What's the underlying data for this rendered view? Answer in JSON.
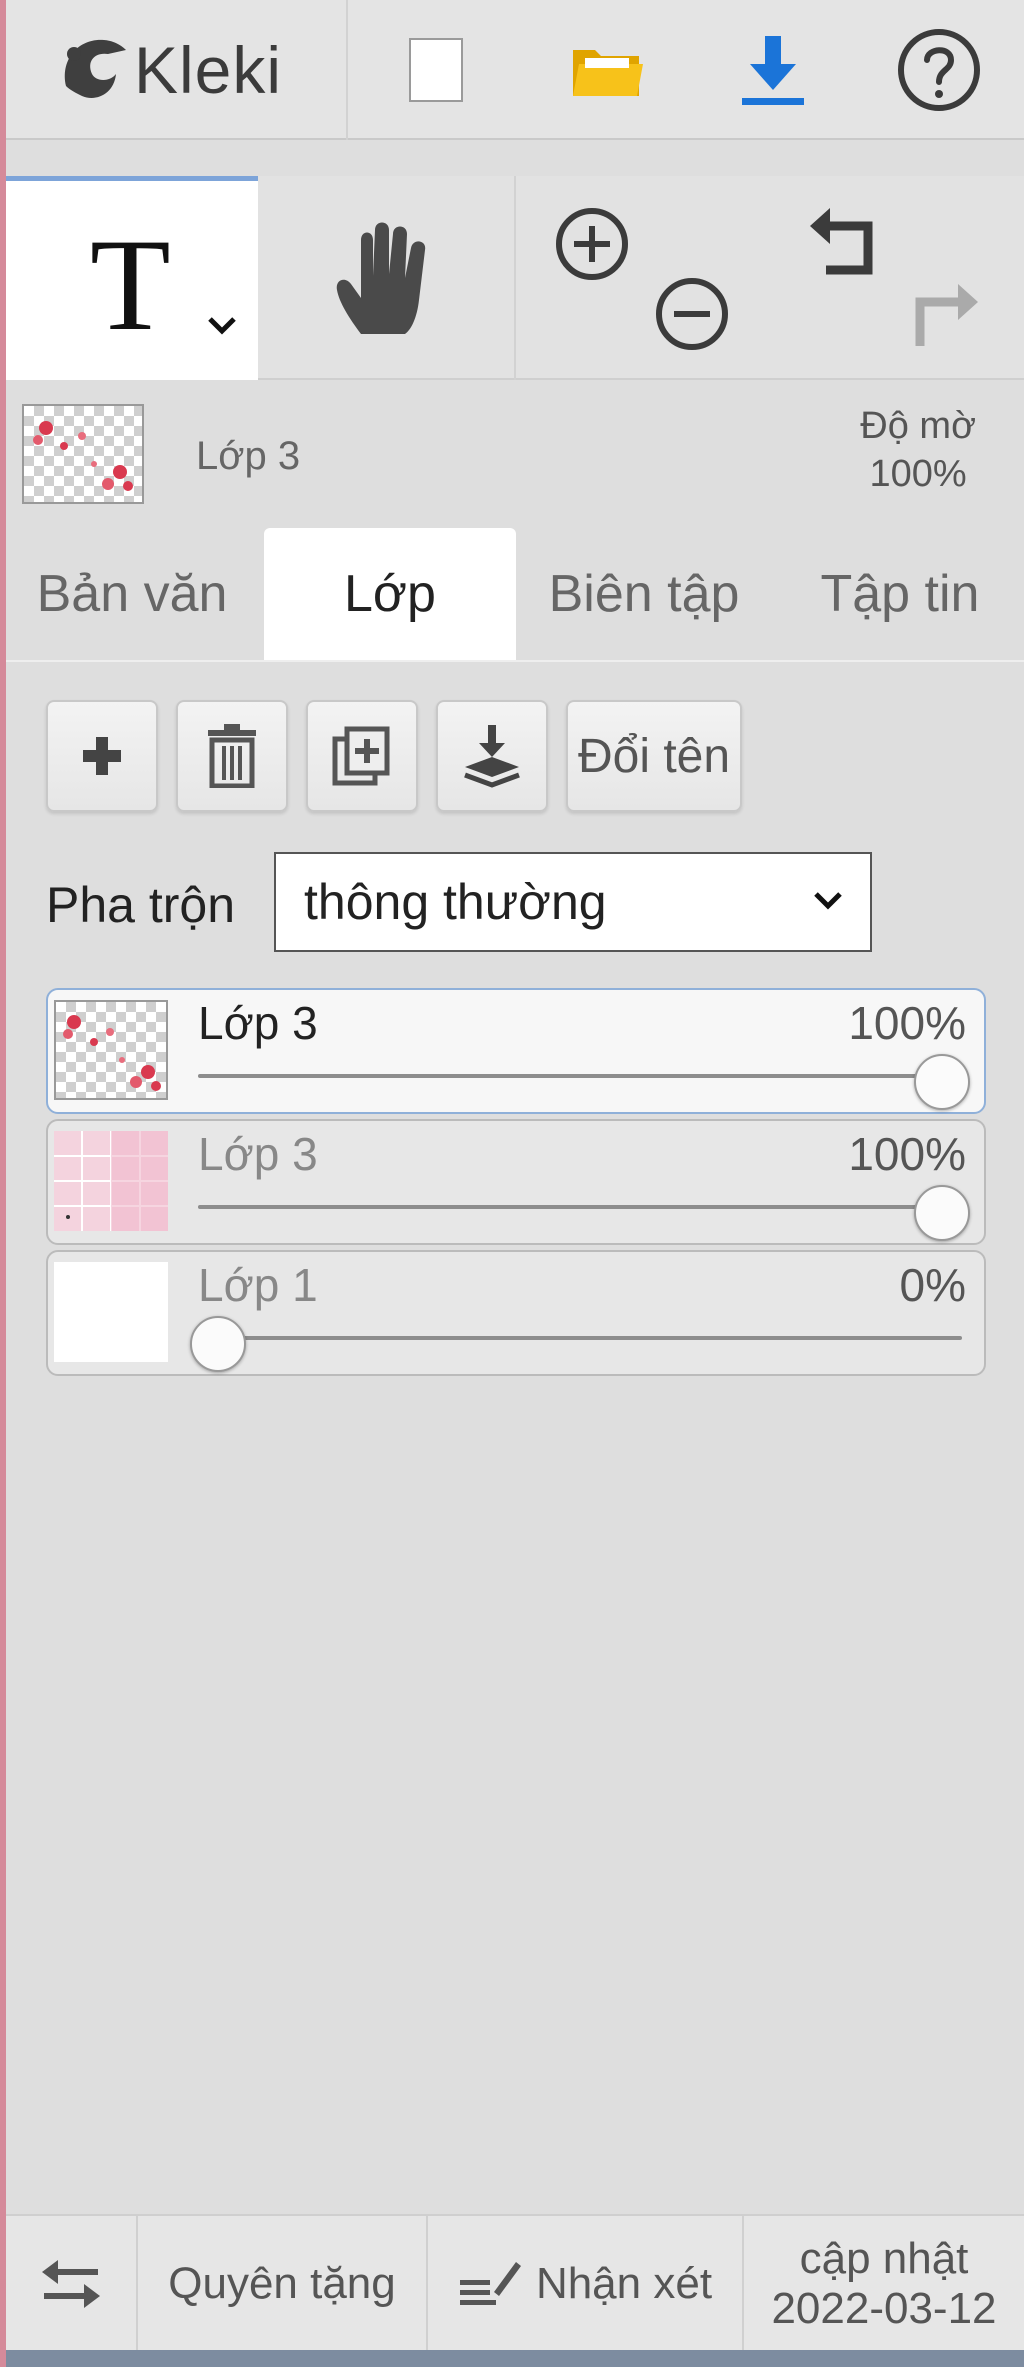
{
  "topbar": {
    "logo_text": "Kleki",
    "icons": [
      "kleki-logo-icon",
      "new-document-icon",
      "open-folder-icon",
      "download-icon",
      "help-icon"
    ],
    "accent_color": "#1b74d8",
    "folder_color": "#f5b400"
  },
  "tools": {
    "text_tool_glyph": "T",
    "icons": [
      "text-tool-icon",
      "chevron-down-icon",
      "hand-tool-icon",
      "zoom-in-icon",
      "zoom-out-icon",
      "undo-icon",
      "redo-icon"
    ]
  },
  "current_layer": {
    "name": "Lớp 3",
    "opacity_label": "Độ mờ",
    "opacity_value": "100%"
  },
  "tabs": [
    {
      "label": "Bản văn",
      "active": false
    },
    {
      "label": "Lớp",
      "active": true
    },
    {
      "label": "Biên tập",
      "active": false
    },
    {
      "label": "Tập tin",
      "active": false
    }
  ],
  "layer_actions": {
    "icons": [
      "add-layer-icon",
      "delete-layer-icon",
      "duplicate-layer-icon",
      "merge-down-icon"
    ],
    "rename_label": "Đổi tên"
  },
  "blend": {
    "label": "Pha trộn",
    "selected": "thông thường"
  },
  "layers": [
    {
      "name": "Lớp 3",
      "opacity": "100%",
      "opacity_fraction": 1.0,
      "selected": true
    },
    {
      "name": "Lớp 3",
      "opacity": "100%",
      "opacity_fraction": 1.0,
      "selected": false
    },
    {
      "name": "Lớp 1",
      "opacity": "0%",
      "opacity_fraction": 0.0,
      "selected": false
    }
  ],
  "footer": {
    "swap_icon": "swap-arrows-icon",
    "donate_label": "Quyên tặng",
    "feedback_label": "Nhận xét",
    "update_label": "cập nhật",
    "update_date": "2022-03-12"
  }
}
